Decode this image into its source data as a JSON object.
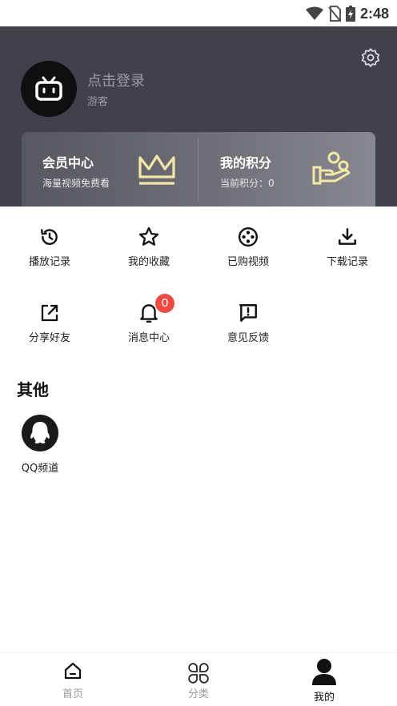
{
  "status_bar": {
    "time": "2:48",
    "icons": [
      "wifi-icon",
      "no-sim-icon",
      "battery-charging-icon"
    ]
  },
  "profile": {
    "login_text": "点击登录",
    "user_type": "游客",
    "settings_icon": "gear-icon",
    "avatar_icon": "bilibili-tv-icon"
  },
  "vip_card": {
    "member": {
      "title": "会员中心",
      "subtitle": "海量视频免费看",
      "icon": "crown-icon"
    },
    "points": {
      "title": "我的积分",
      "subtitle": "当前积分：0",
      "icon": "hand-coins-icon"
    }
  },
  "grid": {
    "items": [
      {
        "label": "播放记录",
        "icon": "history-icon"
      },
      {
        "label": "我的收藏",
        "icon": "star-icon"
      },
      {
        "label": "已购视频",
        "icon": "film-reel-icon"
      },
      {
        "label": "下载记录",
        "icon": "download-icon"
      },
      {
        "label": "分享好友",
        "icon": "share-icon"
      },
      {
        "label": "消息中心",
        "icon": "bell-icon",
        "badge": "0"
      },
      {
        "label": "意见反馈",
        "icon": "feedback-icon"
      }
    ]
  },
  "other": {
    "title": "其他",
    "items": [
      {
        "label": "QQ频道",
        "icon": "qq-icon"
      }
    ]
  },
  "bottom_nav": {
    "items": [
      {
        "label": "首页",
        "icon": "home-icon"
      },
      {
        "label": "分类",
        "icon": "category-icon"
      },
      {
        "label": "我的",
        "icon": "person-icon",
        "active": true
      }
    ]
  },
  "colors": {
    "header_bg": "#40414b",
    "accent_yellow": "#f3e7a6",
    "badge_red": "#ef4a43"
  }
}
